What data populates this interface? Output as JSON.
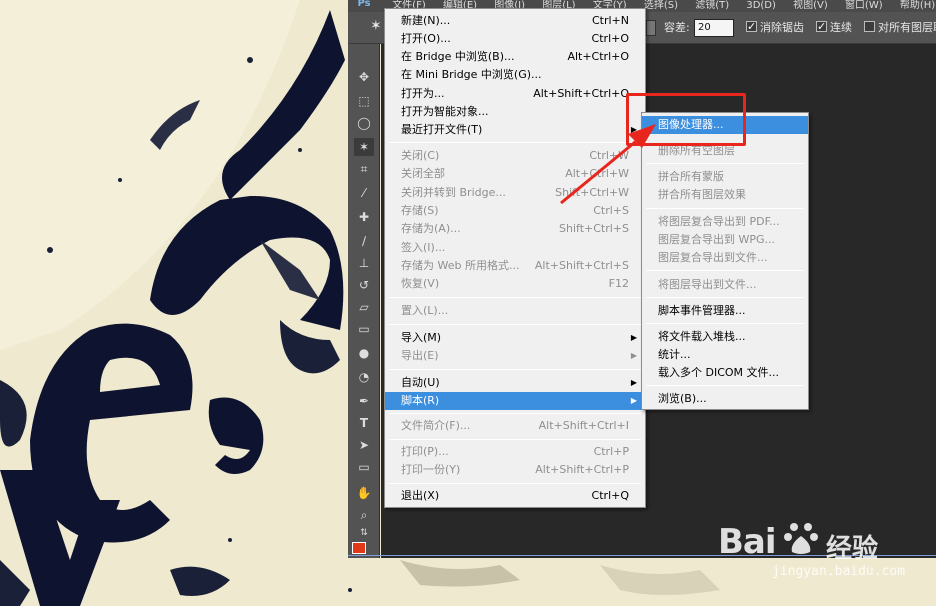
{
  "app": {
    "logo": "Ps",
    "menubar": [
      "文件(F)",
      "编辑(E)",
      "图像(I)",
      "图层(L)",
      "文字(Y)",
      "选择(S)",
      "滤镜(T)",
      "3D(D)",
      "视图(V)",
      "窗口(W)",
      "帮助(H)"
    ]
  },
  "options_bar": {
    "tolerance_label": "容差:",
    "tolerance_value": "20",
    "anti_alias": {
      "label": "消除锯齿",
      "checked": true
    },
    "contiguous": {
      "label": "连续",
      "checked": true
    },
    "all_layers": {
      "label": "对所有图层取",
      "checked": false
    }
  },
  "tools": [
    "move-tool",
    "marquee-tool",
    "lasso-tool",
    "magic-wand-tool",
    "crop-tool",
    "eyedropper-tool",
    "healing-tool",
    "brush-tool",
    "stamp-tool",
    "history-brush-tool",
    "eraser-tool",
    "gradient-tool",
    "blur-tool",
    "dodge-tool",
    "pen-tool",
    "type-tool",
    "path-select-tool",
    "shape-tool",
    "hand-tool",
    "zoom-tool"
  ],
  "foreground_color": "#e0391a",
  "file_menu": {
    "items": [
      {
        "label": "新建(N)...",
        "shortcut": "Ctrl+N"
      },
      {
        "label": "打开(O)...",
        "shortcut": "Ctrl+O"
      },
      {
        "label": "在 Bridge 中浏览(B)...",
        "shortcut": "Alt+Ctrl+O"
      },
      {
        "label": "在 Mini Bridge 中浏览(G)...",
        "shortcut": ""
      },
      {
        "label": "打开为...",
        "shortcut": "Alt+Shift+Ctrl+O"
      },
      {
        "label": "打开为智能对象...",
        "shortcut": ""
      },
      {
        "label": "最近打开文件(T)",
        "shortcut": ""
      },
      {
        "label": "关闭(C)",
        "shortcut": "Ctrl+W"
      },
      {
        "label": "关闭全部",
        "shortcut": "Alt+Ctrl+W"
      },
      {
        "label": "关闭并转到 Bridge...",
        "shortcut": "Shift+Ctrl+W"
      },
      {
        "label": "存储(S)",
        "shortcut": "Ctrl+S"
      },
      {
        "label": "存储为(A)...",
        "shortcut": "Shift+Ctrl+S"
      },
      {
        "label": "签入(I)...",
        "shortcut": ""
      },
      {
        "label": "存储为 Web 所用格式...",
        "shortcut": "Alt+Shift+Ctrl+S"
      },
      {
        "label": "恢复(V)",
        "shortcut": "F12"
      },
      {
        "label": "置入(L)...",
        "shortcut": ""
      },
      {
        "label": "导入(M)",
        "shortcut": ""
      },
      {
        "label": "导出(E)",
        "shortcut": ""
      },
      {
        "label": "自动(U)",
        "shortcut": ""
      },
      {
        "label": "脚本(R)",
        "shortcut": ""
      },
      {
        "label": "文件简介(F)...",
        "shortcut": "Alt+Shift+Ctrl+I"
      },
      {
        "label": "打印(P)...",
        "shortcut": "Ctrl+P"
      },
      {
        "label": "打印一份(Y)",
        "shortcut": "Alt+Shift+Ctrl+P"
      },
      {
        "label": "退出(X)",
        "shortcut": "Ctrl+Q"
      }
    ]
  },
  "scripts_submenu": {
    "items": [
      {
        "label": "图像处理器..."
      },
      {
        "label": "删除所有空图层"
      },
      {
        "label": "拼合所有蒙版"
      },
      {
        "label": "拼合所有图层效果"
      },
      {
        "label": "将图层复合导出到 PDF..."
      },
      {
        "label": "图层复合导出到 WPG..."
      },
      {
        "label": "图层复合导出到文件..."
      },
      {
        "label": "将图层导出到文件..."
      },
      {
        "label": "脚本事件管理器..."
      },
      {
        "label": "将文件载入堆栈..."
      },
      {
        "label": "统计..."
      },
      {
        "label": "载入多个 DICOM 文件..."
      },
      {
        "label": "浏览(B)..."
      }
    ]
  },
  "watermark": {
    "logo": "Bai",
    "cn": "经验",
    "url": "jingyan.baidu.com"
  }
}
